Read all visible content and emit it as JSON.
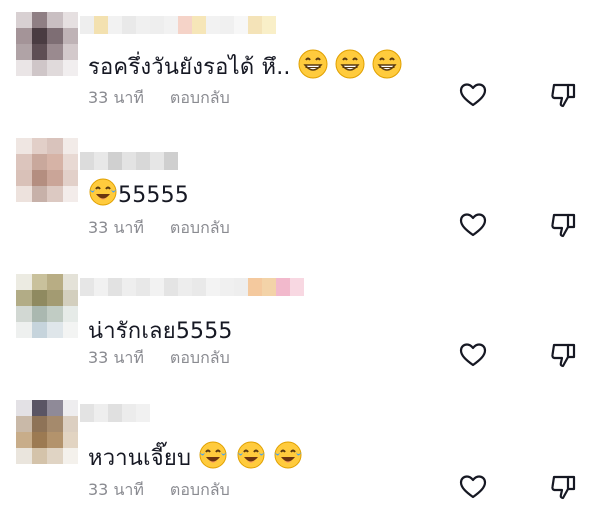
{
  "comments": [
    {
      "text": "รอครึ่งวันยังรอได้ หึ..",
      "emoji_after": [
        "grinning-face-icon",
        "grinning-face-icon",
        "grinning-face-icon"
      ],
      "emoji_before": [],
      "time": "33 นาที",
      "reply_label": "ตอบกลับ"
    },
    {
      "text": "55555",
      "emoji_before": [
        "tears-of-joy-icon"
      ],
      "emoji_after": [],
      "time": "33 นาที",
      "reply_label": "ตอบกลับ"
    },
    {
      "text": "น่ารักเลย5555",
      "emoji_before": [],
      "emoji_after": [],
      "time": "33 นาที",
      "reply_label": "ตอบกลับ"
    },
    {
      "text": "หวานเจี๊ยบ",
      "emoji_before": [],
      "emoji_after": [
        "tears-of-joy-icon",
        "tears-of-joy-icon",
        "tears-of-joy-icon"
      ],
      "time": "33 นาที",
      "reply_label": "ตอบกลับ"
    }
  ],
  "icons": {
    "like": "heart-outline-icon",
    "dislike": "thumbs-down-outline-icon"
  },
  "colors": {
    "text": "#161823",
    "meta": "#8a8b91",
    "icon": "#161823"
  }
}
